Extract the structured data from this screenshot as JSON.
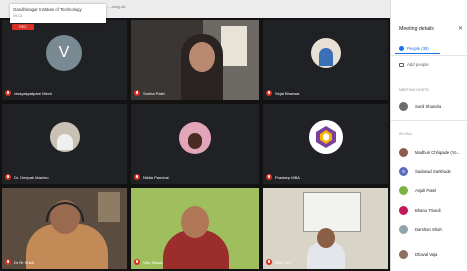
{
  "window": {
    "institute_name": "Gandhinagar Institute of Technology",
    "time": "09:13",
    "url_fragment": "...-xkvg-dk"
  },
  "recording": {
    "label": "REC"
  },
  "grid": {
    "tiles": [
      {
        "id": "tile-1",
        "name": "vinayakpatpare Mech",
        "avatar_letter": "V",
        "avatar_color": "#7a8a93"
      },
      {
        "id": "tile-2",
        "name": "Sneha Patel"
      },
      {
        "id": "tile-3",
        "name": "Sejal Bhavsar"
      },
      {
        "id": "tile-4",
        "name": "Dr. Deepak Mashru"
      },
      {
        "id": "tile-5",
        "name": "Nikita Panchal"
      },
      {
        "id": "tile-6",
        "name": "Pradeep MBA"
      },
      {
        "id": "tile-7",
        "name": "Dr Rr Shah"
      },
      {
        "id": "tile-8",
        "name": "Viky Sawal"
      },
      {
        "id": "tile-9",
        "name": "Rper GIT"
      }
    ]
  },
  "panel": {
    "title": "Meeting details",
    "close_icon": "close-icon",
    "people_tab_label": "People (38)",
    "add_people_label": "Add people",
    "meeting_host_header": "MEETING HOSTS",
    "in_call_header": "IN CALL",
    "hosts": [
      {
        "name": "Sunil Shandra",
        "avatar_color": "#6b6b6b"
      }
    ],
    "people": [
      {
        "name": "Madhuri Chhipade (Yo...",
        "avatar_color": "#8a5a4a"
      },
      {
        "name": "Sadanad Sarkhude",
        "avatar_color": "#5c6bc0",
        "initial": "S"
      },
      {
        "name": "Anjali Patel",
        "avatar_color": "#7cb342"
      },
      {
        "name": "Bhanu Trivedi",
        "avatar_color": "#c2185b"
      },
      {
        "name": "Darshan Shah",
        "avatar_color": "#90a4ae"
      },
      {
        "name": "Dhaval Vaja",
        "avatar_color": "#8d6e63"
      }
    ]
  },
  "accent": {
    "mute_red": "#d93025",
    "google_blue": "#1a73e8"
  }
}
